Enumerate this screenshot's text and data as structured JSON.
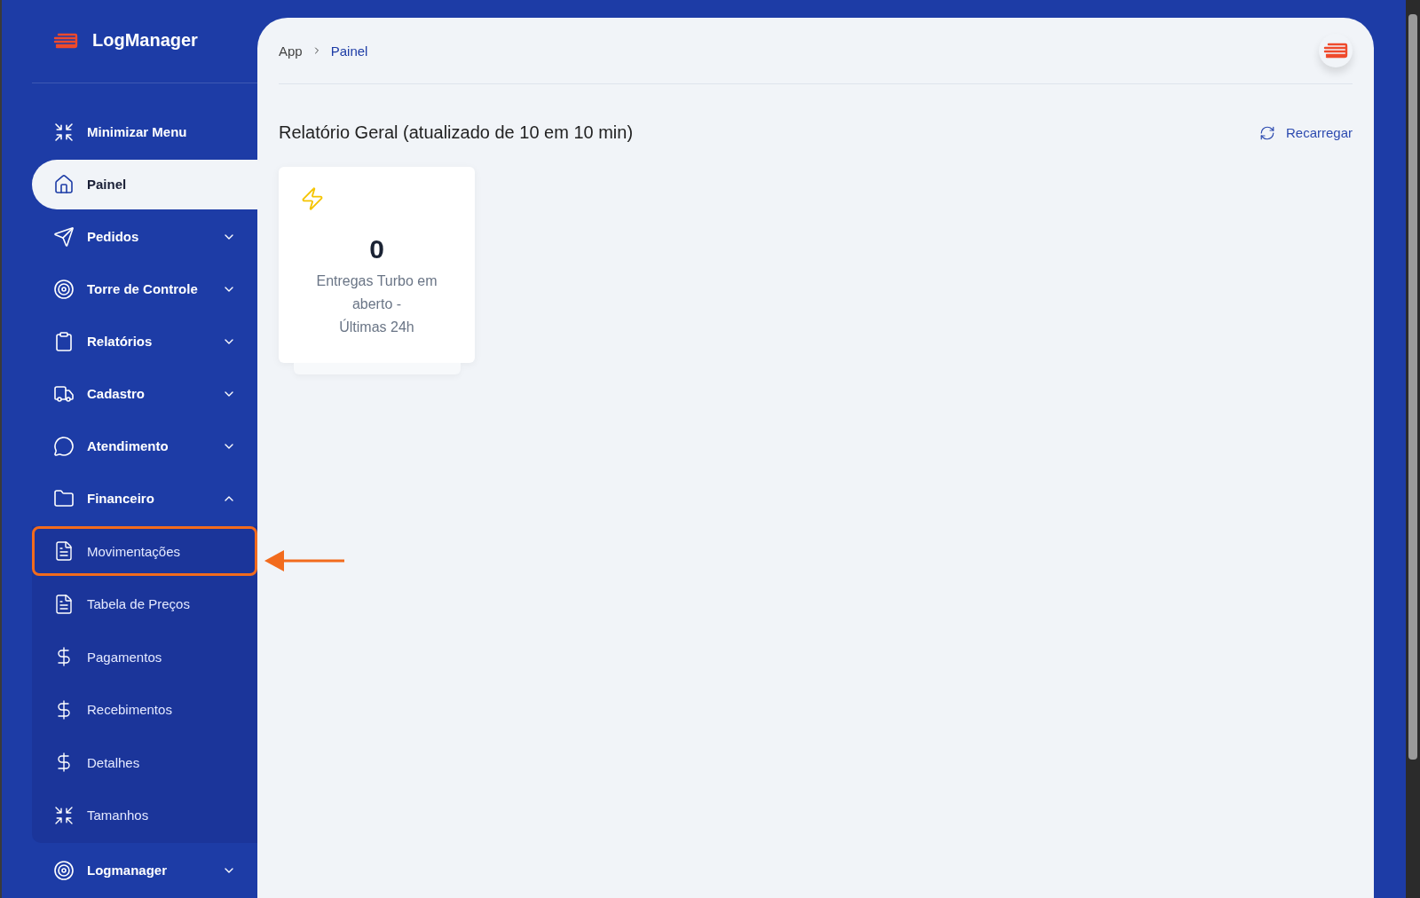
{
  "brand": {
    "name": "LogManager"
  },
  "sidebar": {
    "items": [
      {
        "label": "Minimizar Menu",
        "kind": "action",
        "selected": false
      },
      {
        "label": "Painel",
        "kind": "link",
        "selected": true
      },
      {
        "label": "Pedidos",
        "kind": "group",
        "selected": false,
        "expanded": false
      },
      {
        "label": "Torre de Controle",
        "kind": "group",
        "selected": false,
        "expanded": false
      },
      {
        "label": "Relatórios",
        "kind": "group",
        "selected": false,
        "expanded": false
      },
      {
        "label": "Cadastro",
        "kind": "group",
        "selected": false,
        "expanded": false
      },
      {
        "label": "Atendimento",
        "kind": "group",
        "selected": false,
        "expanded": false
      },
      {
        "label": "Financeiro",
        "kind": "group",
        "selected": false,
        "expanded": true,
        "children": [
          {
            "label": "Movimentações",
            "selected": false,
            "highlighted": true
          },
          {
            "label": "Tabela de Preços",
            "selected": false,
            "highlighted": false
          },
          {
            "label": "Pagamentos",
            "selected": false,
            "highlighted": false
          },
          {
            "label": "Recebimentos",
            "selected": false,
            "highlighted": false
          },
          {
            "label": "Detalhes",
            "selected": false,
            "highlighted": false
          },
          {
            "label": "Tamanhos",
            "selected": false,
            "highlighted": false
          }
        ]
      },
      {
        "label": "Logmanager",
        "kind": "group",
        "selected": false,
        "expanded": false
      }
    ]
  },
  "breadcrumb": [
    "App",
    "Painel"
  ],
  "report": {
    "title": "Relatório Geral (atualizado de 10 em 10 min)",
    "reload": "Recarregar",
    "cards": [
      {
        "value": "0",
        "lines": [
          "Entregas Turbo em",
          "aberto -",
          "Últimas 24h"
        ]
      }
    ]
  }
}
